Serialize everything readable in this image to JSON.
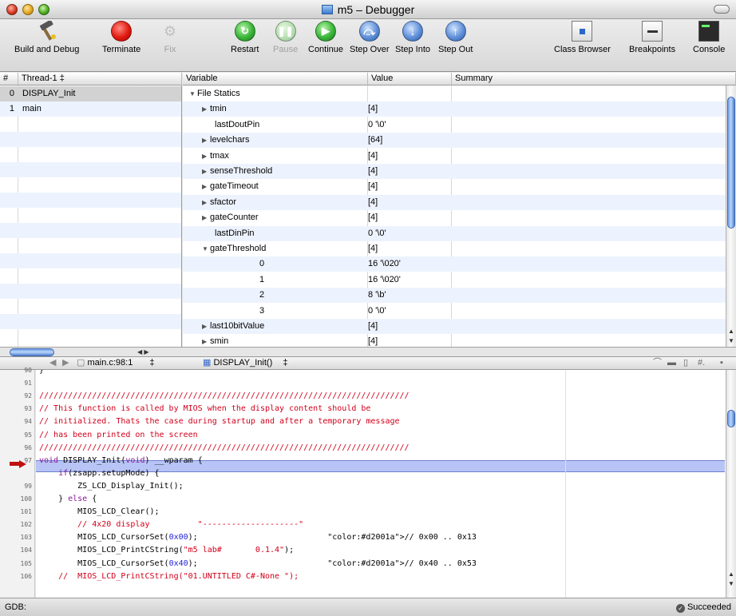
{
  "window": {
    "title": "m5 – Debugger"
  },
  "toolbar": {
    "build_and_debug": "Build and Debug",
    "terminate": "Terminate",
    "fix": "Fix",
    "restart": "Restart",
    "pause": "Pause",
    "continue": "Continue",
    "step_over": "Step Over",
    "step_into": "Step Into",
    "step_out": "Step Out",
    "class_browser": "Class Browser",
    "breakpoints": "Breakpoints",
    "console": "Console"
  },
  "threads": {
    "col_num": "#",
    "col_thread": "Thread-1 ‡",
    "rows": [
      {
        "num": "0",
        "name": "DISPLAY_Init"
      },
      {
        "num": "1",
        "name": "main"
      }
    ]
  },
  "variables": {
    "col_variable": "Variable",
    "col_value": "Value",
    "col_summary": "Summary",
    "rows": [
      {
        "name": "File Statics",
        "value": "",
        "expander": "open"
      },
      {
        "name": "tmin",
        "value": "[4]",
        "expander": "closed"
      },
      {
        "name": "lastDoutPin",
        "value": "0 '\\0'",
        "expander": "none"
      },
      {
        "name": "levelchars",
        "value": "[64]",
        "expander": "closed"
      },
      {
        "name": "tmax",
        "value": "[4]",
        "expander": "closed"
      },
      {
        "name": "senseThreshold",
        "value": "[4]",
        "expander": "closed"
      },
      {
        "name": "gateTimeout",
        "value": "[4]",
        "expander": "closed"
      },
      {
        "name": "sfactor",
        "value": "[4]",
        "expander": "closed"
      },
      {
        "name": "gateCounter",
        "value": "[4]",
        "expander": "closed"
      },
      {
        "name": "lastDinPin",
        "value": "0 '\\0'",
        "expander": "none"
      },
      {
        "name": "gateThreshold",
        "value": "[4]",
        "expander": "open"
      },
      {
        "name": "0",
        "value": "16 '\\020'",
        "expander": "none"
      },
      {
        "name": "1",
        "value": "16 '\\020'",
        "expander": "none"
      },
      {
        "name": "2",
        "value": "8 '\\b'",
        "expander": "none"
      },
      {
        "name": "3",
        "value": "0 '\\0'",
        "expander": "none"
      },
      {
        "name": "last10bitValue",
        "value": "[4]",
        "expander": "closed"
      },
      {
        "name": "smin",
        "value": "[4]",
        "expander": "closed"
      }
    ]
  },
  "navbar": {
    "file": "main.c:98:1",
    "function": "DISPLAY_Init()"
  },
  "editor": {
    "lines": [
      {
        "num": "90",
        "text": "}"
      },
      {
        "num": "91",
        "text": ""
      },
      {
        "num": "92",
        "text": "/////////////////////////////////////////////////////////////////////////////"
      },
      {
        "num": "93",
        "text": "// This function is called by MIOS when the display content should be"
      },
      {
        "num": "94",
        "text": "// initialized. Thats the case during startup and after a temporary message"
      },
      {
        "num": "95",
        "text": "// has been printed on the screen"
      },
      {
        "num": "96",
        "text": "/////////////////////////////////////////////////////////////////////////////"
      },
      {
        "num": "97",
        "text": "void DISPLAY_Init(void) __wparam {"
      },
      {
        "num": "",
        "text": "    if(zsapp.setupMode) {"
      },
      {
        "num": "99",
        "text": "        ZS_LCD_Display_Init();"
      },
      {
        "num": "100",
        "text": "    } else {"
      },
      {
        "num": "101",
        "text": "        MIOS_LCD_Clear();"
      },
      {
        "num": "102",
        "text": "        // 4x20 display          \"--------------------\""
      },
      {
        "num": "103",
        "text": "        MIOS_LCD_CursorSet(0x00);                           // 0x00 .. 0x13"
      },
      {
        "num": "104",
        "text": "        MIOS_LCD_PrintCString(\"m5 lab#       0.1.4\");"
      },
      {
        "num": "105",
        "text": "        MIOS_LCD_CursorSet(0x40);                           // 0x40 .. 0x53"
      },
      {
        "num": "106",
        "text": "    //  MIOS_LCD_PrintCString(\"01.UNTITLED C#-None \");"
      }
    ]
  },
  "status": {
    "left": "GDB:",
    "right": "Succeeded"
  },
  "colors": {
    "comment": "#d2001a",
    "keyword": "#8a1a9a",
    "number": "#2222dd",
    "highlight": "#b7c4f5",
    "pc_arrow": "#c01010"
  }
}
